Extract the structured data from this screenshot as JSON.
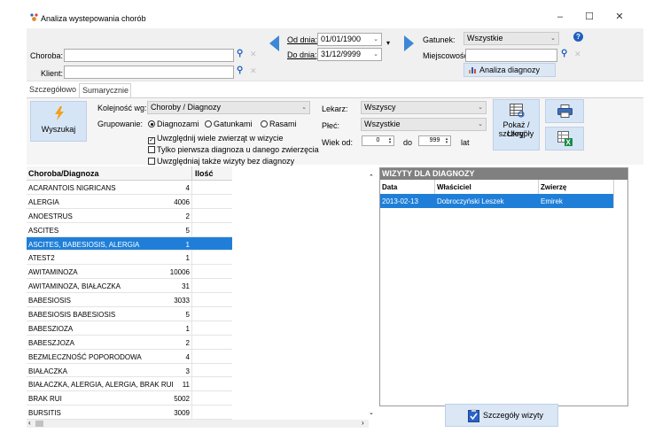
{
  "window": {
    "title": "Analiza wystepowania chorób",
    "minimize": "–",
    "maximize": "☐",
    "close": "✕"
  },
  "filters": {
    "choroba_label": "Choroba:",
    "choroba_value": "",
    "klient_label": "Klient:",
    "klient_value": "",
    "od_dnia_label": "Od dnia:",
    "od_dnia_value": "01/01/1900",
    "do_dnia_label": "Do dnia:",
    "do_dnia_value": "31/12/9999",
    "gatunek_label": "Gatunek:",
    "gatunek_value": "Wszystkie",
    "miejscowosc_label": "Miejscowość:",
    "miejscowosc_value": "",
    "help_glyph": "?",
    "analiza_button": "Analiza diagnozy"
  },
  "tabs": [
    {
      "label": "Szczegółowo",
      "active": false
    },
    {
      "label": "Sumarycznie",
      "active": true
    }
  ],
  "options": {
    "search_button": "Wyszukaj",
    "kolejnosc_label": "Kolejność wg:",
    "kolejnosc_value": "Choroby / Diagnozy",
    "grupowanie_label": "Grupowanie:",
    "radio_diagnozami": "Diagnozami",
    "radio_gatunkami": "Gatunkami",
    "radio_rasami": "Rasami",
    "check1": "Uwzględnij wiele zwierząt w wizycie",
    "check2": "Tylko pierwsza diagnoza u danego zwierzęcia",
    "check3": "Uwzględniaj także wizyty bez diagnozy",
    "lekarz_label": "Lekarz:",
    "lekarz_value": "Wszyscy",
    "plec_label": "Płeć:",
    "plec_value": "Wszystkie",
    "wiek_label": "Wiek od:",
    "wiek_from": "0",
    "wiek_do_label": "do",
    "wiek_to": "999",
    "wiek_unit": "lat",
    "toggle_button_line1": "Pokaż / Ukryj",
    "toggle_button_line2": "szczegóły"
  },
  "grid": {
    "col_name": "Choroba/Diagnoza",
    "col_count": "Ilość",
    "rows": [
      {
        "name": "ACARANTOIS NIGRICANS",
        "count": "4"
      },
      {
        "name": "ALERGIA",
        "count": "4006"
      },
      {
        "name": "ANOESTRUS",
        "count": "2"
      },
      {
        "name": "ASCITES",
        "count": "5"
      },
      {
        "name": "ASCITES, BABESIOSIS, ALERGIA",
        "count": "1"
      },
      {
        "name": "ATEST2",
        "count": "1"
      },
      {
        "name": "AWITAMINOZA",
        "count": "10006"
      },
      {
        "name": "AWITAMINOZA, BIAŁACZKA",
        "count": "31"
      },
      {
        "name": "BABESIOSIS",
        "count": "3033"
      },
      {
        "name": "BABESIOSIS BABESIOSIS",
        "count": "5"
      },
      {
        "name": "BABESZIOZA",
        "count": "1"
      },
      {
        "name": "BABESZJOZA",
        "count": "2"
      },
      {
        "name": "BEZMLECZNOŚĆ POPORODOWA",
        "count": "4"
      },
      {
        "name": "BIAŁACZKA",
        "count": "3"
      },
      {
        "name": "BIAŁACZKA, ALERGIA, ALERGIA, BRAK RUI",
        "count": "11"
      },
      {
        "name": "BRAK RUI",
        "count": "5002"
      },
      {
        "name": "BURSITIS",
        "count": "3009"
      }
    ]
  },
  "visits": {
    "header": "WIZYTY DLA DIAGNOZY",
    "col_data": "Data",
    "col_owner": "Właściciel",
    "col_animal": "Zwierzę",
    "row": {
      "data": "2013-02-13",
      "owner": "Dobroczyński Leszek",
      "animal": "Emirek"
    },
    "details_button": "Szczegóły wizyty"
  },
  "colors": {
    "selection": "#1f7fd8",
    "accent_blue": "#1f5fbf",
    "panel_header": "#808080"
  }
}
